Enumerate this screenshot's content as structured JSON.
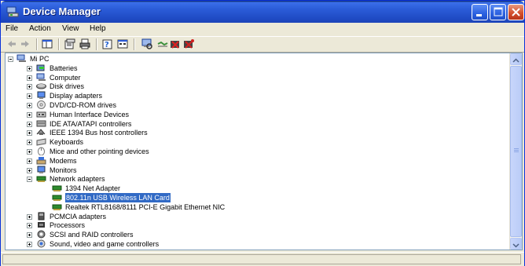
{
  "window": {
    "title": "Device Manager"
  },
  "menu": {
    "items": [
      "File",
      "Action",
      "View",
      "Help"
    ]
  },
  "toolbar": {
    "buttons": [
      "back-icon",
      "forward-icon",
      "show-hide-tree-icon",
      "properties-icon",
      "print-icon",
      "help-icon",
      "view-icon",
      "scan-hardware-icon",
      "update-driver-icon",
      "uninstall-icon",
      "disable-icon"
    ]
  },
  "tree": {
    "root": {
      "label": "Mi PC",
      "icon": "computer-icon"
    },
    "items": [
      {
        "label": "Batteries",
        "icon": "battery-icon"
      },
      {
        "label": "Computer",
        "icon": "computer-icon"
      },
      {
        "label": "Disk drives",
        "icon": "disk-drive-icon"
      },
      {
        "label": "Display adapters",
        "icon": "display-adapter-icon"
      },
      {
        "label": "DVD/CD-ROM drives",
        "icon": "cdrom-icon"
      },
      {
        "label": "Human Interface Devices",
        "icon": "hid-icon"
      },
      {
        "label": "IDE ATA/ATAPI controllers",
        "icon": "ide-controller-icon"
      },
      {
        "label": "IEEE 1394 Bus host controllers",
        "icon": "firewire-icon"
      },
      {
        "label": "Keyboards",
        "icon": "keyboard-icon"
      },
      {
        "label": "Mice and other pointing devices",
        "icon": "mouse-icon"
      },
      {
        "label": "Modems",
        "icon": "modem-icon"
      },
      {
        "label": "Monitors",
        "icon": "monitor-icon"
      },
      {
        "label": "Network adapters",
        "icon": "network-adapter-icon",
        "expanded": true,
        "children": [
          {
            "label": "1394 Net Adapter",
            "icon": "network-card-icon"
          },
          {
            "label": "802.11n USB Wireless LAN Card",
            "icon": "network-card-icon",
            "selected": true
          },
          {
            "label": "Realtek RTL8168/8111 PCI-E Gigabit Ethernet NIC",
            "icon": "network-card-icon"
          }
        ]
      },
      {
        "label": "PCMCIA adapters",
        "icon": "pcmcia-icon"
      },
      {
        "label": "Processors",
        "icon": "processor-icon"
      },
      {
        "label": "SCSI and RAID controllers",
        "icon": "scsi-icon"
      },
      {
        "label": "Sound, video and game controllers",
        "icon": "sound-icon"
      }
    ]
  },
  "colors": {
    "selection": "#316AC5",
    "titlebar": "#2A5BD7",
    "close_button": "#D4502E"
  }
}
